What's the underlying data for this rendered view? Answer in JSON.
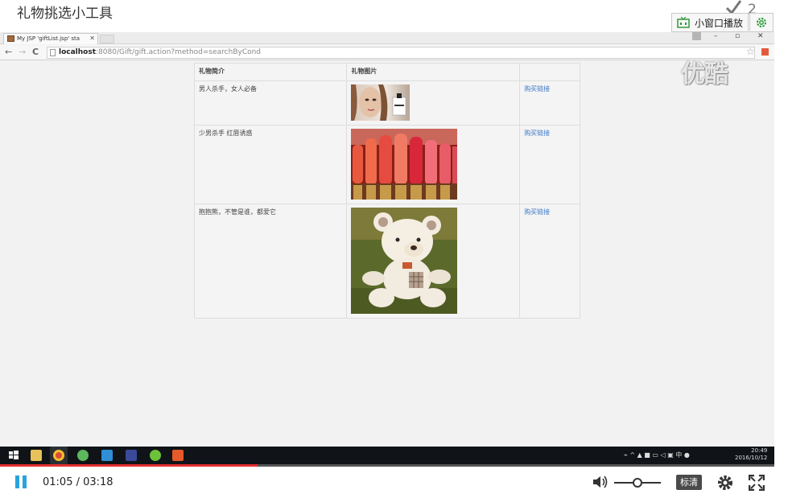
{
  "site": {
    "title": "礼物挑选小工具",
    "counter": "2",
    "mini_window_label": "小窗口播放"
  },
  "browser": {
    "tab_title": "My JSP 'giftList.jsp' sta",
    "url_host": "localhost",
    "url_rest": ":8080/Gift/gift.action?method=searchByCond"
  },
  "watermark": "优酷",
  "table": {
    "headers": [
      "礼物简介",
      "礼物图片",
      ""
    ],
    "rows": [
      {
        "intro": "男人杀手，女人必备",
        "link": "购买链接",
        "image": "perfume-photo"
      },
      {
        "intro": "少男杀手 红唇诱惑",
        "link": "购买链接",
        "image": "lipstick-photo"
      },
      {
        "intro": "抱抱熊，不管是谁，都爱它",
        "link": "购买链接",
        "image": "teddy-bear-photo"
      }
    ]
  },
  "taskbar": {
    "clock_time": "20:49",
    "clock_date": "2016/10/12"
  },
  "player": {
    "current_time": "01:05",
    "total_time": "03:18",
    "time_display": "01:05 / 03:18",
    "progress_fraction": 0.333,
    "volume_fraction": 0.5,
    "quality_label": "标清"
  },
  "colors": {
    "accent_blue": "#2aa3db",
    "progress_red": "#e62e2e",
    "link_blue": "#3b78c9",
    "gear_green": "#2e9a3a"
  }
}
